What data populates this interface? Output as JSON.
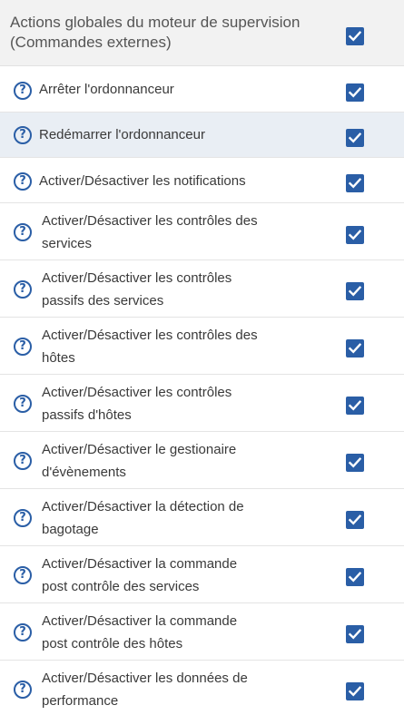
{
  "header": {
    "title": "Actions globales du moteur de supervision (Commandes externes)",
    "checked": true
  },
  "colors": {
    "accent": "#2a5ea6",
    "header_bg": "#f2f2f2",
    "highlight_bg": "#e9eef4"
  },
  "icons": {
    "help": "question-circle-icon",
    "checkbox": "checkmark-icon"
  },
  "help_glyph": "?",
  "rows": [
    {
      "label": "Arrêter l'ordonnanceur",
      "checked": true
    },
    {
      "label": "Redémarrer l'ordonnanceur",
      "checked": true,
      "highlighted": true
    },
    {
      "label": "Activer/Désactiver les notifications",
      "checked": true
    },
    {
      "line1": "Activer/Désactiver les contrôles des",
      "line2": "services",
      "checked": true
    },
    {
      "line1": "Activer/Désactiver les contrôles",
      "line2": "passifs des services",
      "checked": true
    },
    {
      "line1": "Activer/Désactiver les contrôles des",
      "line2": "hôtes",
      "checked": true
    },
    {
      "line1": "Activer/Désactiver les contrôles",
      "line2": "passifs d'hôtes",
      "checked": true
    },
    {
      "line1": "Activer/Désactiver le gestionaire",
      "line2": "d'évènements",
      "checked": true
    },
    {
      "line1": "Activer/Désactiver la détection de",
      "line2": "bagotage",
      "checked": true
    },
    {
      "line1": "Activer/Désactiver la commande",
      "line2": "post contrôle des services",
      "checked": true
    },
    {
      "line1": "Activer/Désactiver la commande",
      "line2": "post contrôle des hôtes",
      "checked": true
    },
    {
      "line1": "Activer/Désactiver les données de",
      "line2": "performance",
      "checked": true
    }
  ]
}
